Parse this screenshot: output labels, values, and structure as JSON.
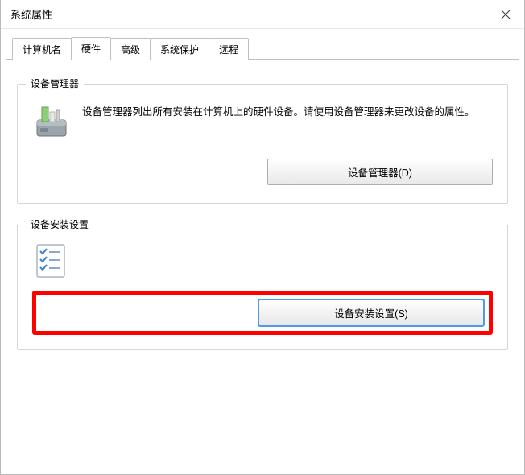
{
  "window": {
    "title": "系统属性"
  },
  "tabs": {
    "items": [
      {
        "label": "计算机名"
      },
      {
        "label": "硬件"
      },
      {
        "label": "高级"
      },
      {
        "label": "系统保护"
      },
      {
        "label": "远程"
      }
    ],
    "active_index": 1
  },
  "groups": {
    "device_manager": {
      "title": "设备管理器",
      "description": "设备管理器列出所有安装在计算机上的硬件设备。请使用设备管理器来更改设备的属性。",
      "button_label": "设备管理器(D)"
    },
    "install_settings": {
      "title": "设备安装设置",
      "button_label": "设备安装设置(S)"
    }
  }
}
